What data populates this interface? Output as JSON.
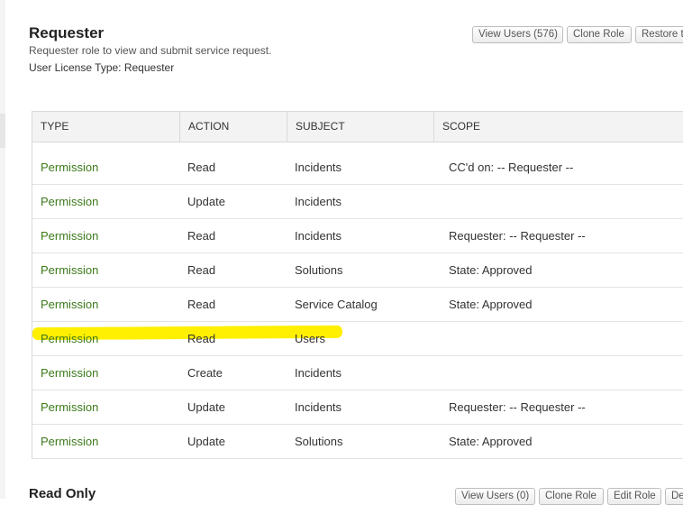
{
  "role": {
    "title": "Requester",
    "description": "Requester role to view and submit service request.",
    "license": "User License Type: Requester"
  },
  "buttons": {
    "view_users": "View Users (576)",
    "clone_role": "Clone Role",
    "restore": "Restore t"
  },
  "table": {
    "headers": [
      "TYPE",
      "ACTION",
      "SUBJECT",
      "SCOPE"
    ],
    "rows": [
      {
        "type": "Permission",
        "action": "Read",
        "subject": "Incidents",
        "scope": "CC'd on: -- Requester --"
      },
      {
        "type": "Permission",
        "action": "Update",
        "subject": "Incidents",
        "scope": ""
      },
      {
        "type": "Permission",
        "action": "Read",
        "subject": "Incidents",
        "scope": "Requester: -- Requester --"
      },
      {
        "type": "Permission",
        "action": "Read",
        "subject": "Solutions",
        "scope": "State: Approved"
      },
      {
        "type": "Permission",
        "action": "Read",
        "subject": "Service Catalog",
        "scope": "State: Approved"
      },
      {
        "type": "Permission",
        "action": "Read",
        "subject": "Users",
        "scope": ""
      },
      {
        "type": "Permission",
        "action": "Create",
        "subject": "Incidents",
        "scope": ""
      },
      {
        "type": "Permission",
        "action": "Update",
        "subject": "Incidents",
        "scope": "Requester: -- Requester --"
      },
      {
        "type": "Permission",
        "action": "Update",
        "subject": "Solutions",
        "scope": "State: Approved"
      }
    ],
    "highlighted_row_index": 5,
    "highlight_color": "#ffef00"
  },
  "next_role": {
    "title": "Read Only",
    "buttons": [
      "View Users (0)",
      "Clone Role",
      "Edit Role",
      "De"
    ]
  },
  "colors": {
    "permission_text": "#3c7a1a",
    "header_bg": "#f3f3f3"
  }
}
